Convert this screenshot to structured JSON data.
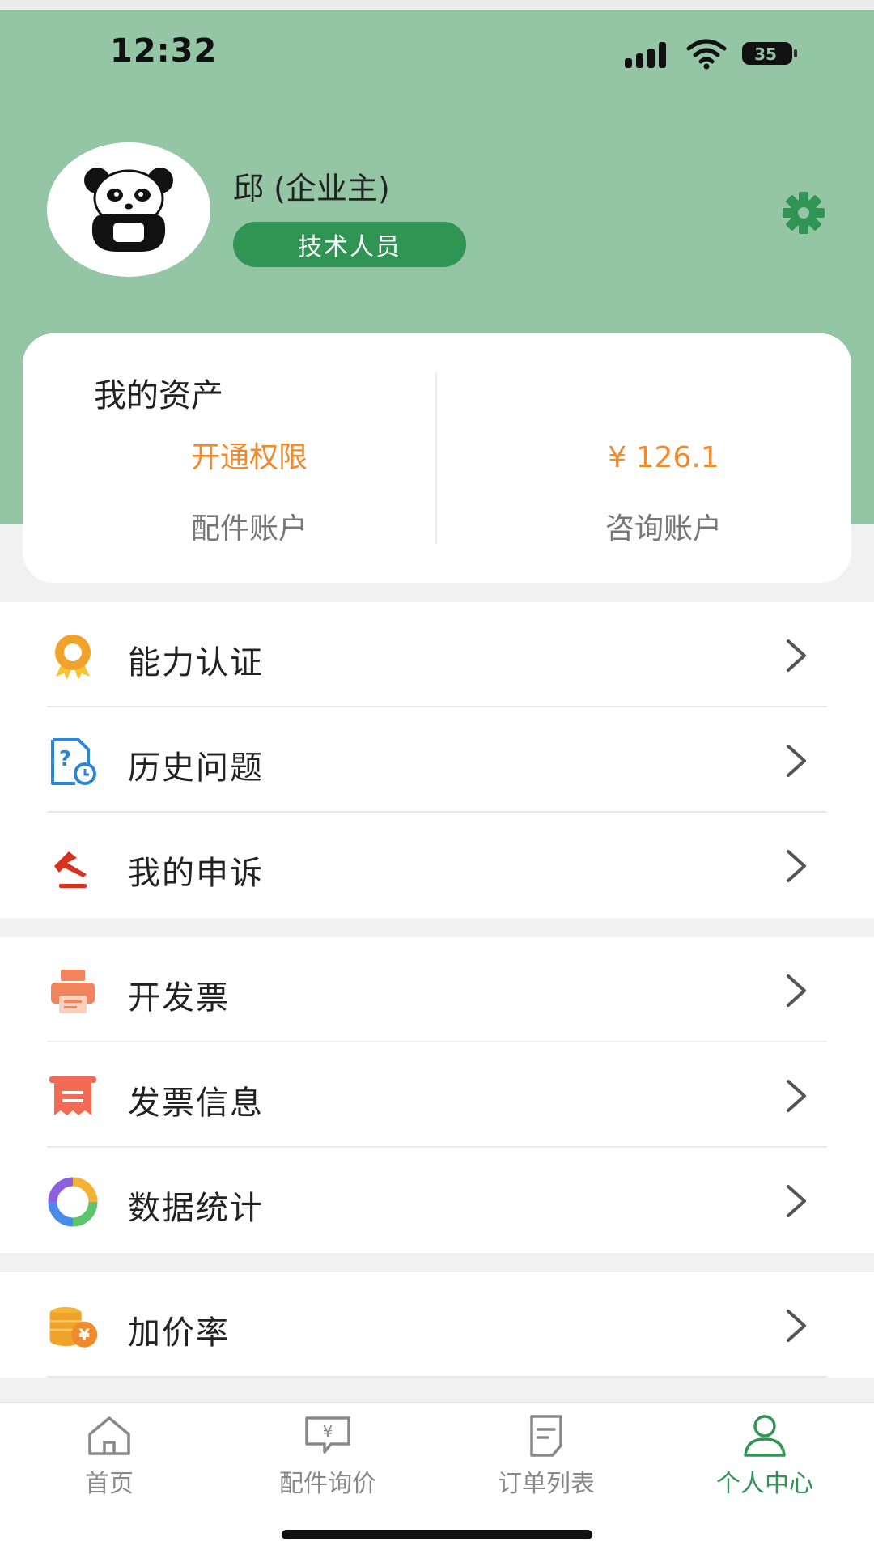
{
  "status_bar": {
    "time": "12:32",
    "battery": "35"
  },
  "profile": {
    "name": "邱 (企业主)",
    "role": "技术人员",
    "avatar_icon": "panda-avatar-icon",
    "settings_icon": "gear-icon"
  },
  "assets": {
    "title": "我的资产",
    "left": {
      "value": "开通权限",
      "label": "配件账户"
    },
    "right": {
      "value": "¥ 126.1",
      "label": "咨询账户"
    }
  },
  "menu": {
    "group1": [
      {
        "label": "能力认证",
        "icon": "badge-award-icon"
      },
      {
        "label": "历史问题",
        "icon": "question-history-icon"
      },
      {
        "label": "我的申诉",
        "icon": "appeal-gavel-icon"
      }
    ],
    "group2": [
      {
        "label": "开发票",
        "icon": "printer-icon"
      },
      {
        "label": "发票信息",
        "icon": "invoice-receipt-icon"
      },
      {
        "label": "数据统计",
        "icon": "donut-chart-icon"
      }
    ],
    "group3": [
      {
        "label": "加价率",
        "icon": "coins-yen-icon"
      }
    ]
  },
  "tabs": [
    {
      "label": "首页",
      "icon": "home-icon"
    },
    {
      "label": "配件询价",
      "icon": "chat-yen-icon"
    },
    {
      "label": "订单列表",
      "icon": "order-list-icon"
    },
    {
      "label": "个人中心",
      "icon": "person-icon"
    }
  ],
  "colors": {
    "header_bg": "#94c6a6",
    "accent_green": "#2f9454",
    "asset_orange": "#f08a2c"
  }
}
